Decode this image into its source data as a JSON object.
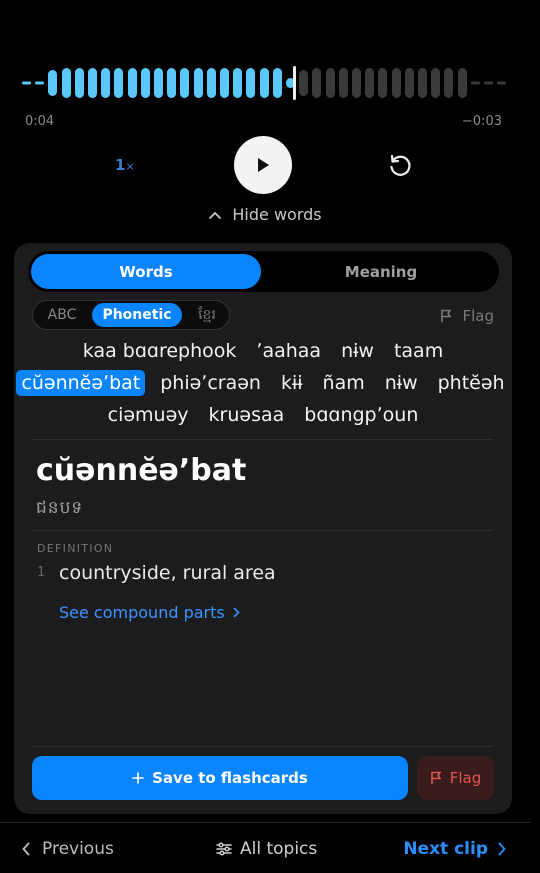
{
  "player": {
    "progress": 0.58,
    "elapsed": "0:04",
    "remaining": "−0:03",
    "speed_value": "1",
    "speed_suffix": "×",
    "hide_words_label": "Hide words",
    "colors": {
      "played": "#5ac8fa",
      "unplayed": "#3a3a3c",
      "cursor": "#eeeeee"
    }
  },
  "tabs": {
    "words_label": "Words",
    "meaning_label": "Meaning",
    "active": "Words"
  },
  "script_toggle": {
    "options": [
      "ABC",
      "Phonetic",
      "ខ្មែរ"
    ],
    "selected": "Phonetic"
  },
  "flag_label": "Flag",
  "sentence": {
    "lines": [
      [
        "kaa bɑɑrephook",
        "ʼaahaa",
        "nɨw",
        "taam"
      ],
      [
        "cŭənnĕəʼbat",
        "phiəʼcraən",
        "kɨɨ",
        "ñam",
        "nɨw",
        "phtĕəh"
      ],
      [
        "ciəmuəy",
        "kruəsaa",
        "bɑɑngpʼoun"
      ]
    ],
    "selected_word": "cŭənnĕəʼbat"
  },
  "detail": {
    "word": "cŭənnĕəʼbat",
    "khmer": "ជនបទ",
    "definition_label": "DEFINITION",
    "definitions": [
      {
        "num": "1",
        "text": "countryside, rural area"
      }
    ],
    "compound_label": "See compound parts"
  },
  "actions": {
    "save_label": "Save to flashcards",
    "flag_label": "Flag"
  },
  "nav": {
    "previous_label": "Previous",
    "topics_label": "All topics",
    "next_label": "Next clip"
  },
  "colors": {
    "accent": "#0a84ff",
    "link": "#3b95ff",
    "flag_red": "#e0554f"
  }
}
